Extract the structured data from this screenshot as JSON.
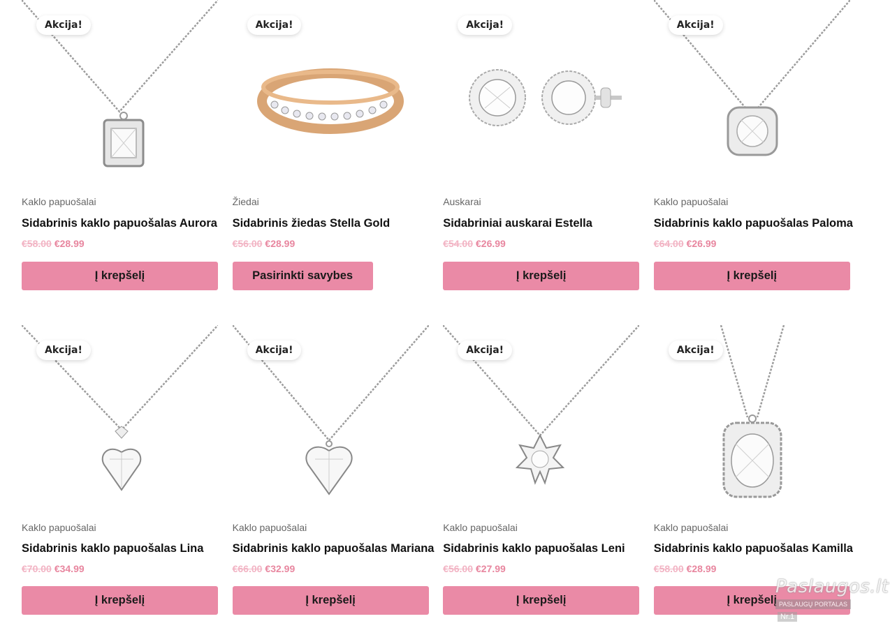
{
  "badge_label": "Akcija!",
  "products": [
    {
      "category": "Kaklo papuošalai",
      "title": "Sidabrinis kaklo papuošalas Aurora",
      "old_price": "€58.00",
      "price": "€28.99",
      "button": "Į krepšelį",
      "image": "pendant-rectangle"
    },
    {
      "category": "Žiedai",
      "title": "Sidabrinis žiedas Stella Gold",
      "old_price": "€56.00",
      "price": "€28.99",
      "button": "Pasirinkti savybes",
      "image": "gold-ring"
    },
    {
      "category": "Auskarai",
      "title": "Sidabriniai auskarai Estella",
      "old_price": "€54.00",
      "price": "€26.99",
      "button": "Į krepšelį",
      "image": "stud-earrings"
    },
    {
      "category": "Kaklo papuošalai",
      "title": "Sidabrinis kaklo papuošalas Paloma",
      "old_price": "€64.00",
      "price": "€26.99",
      "button": "Į krepšelį",
      "image": "pendant-cushion"
    },
    {
      "category": "Kaklo papuošalai",
      "title": "Sidabrinis kaklo papuošalas Lina",
      "old_price": "€70.00",
      "price": "€34.99",
      "button": "Į krepšelį",
      "image": "pendant-heart"
    },
    {
      "category": "Kaklo papuošalai",
      "title": "Sidabrinis kaklo papuošalas Mariana",
      "old_price": "€66.00",
      "price": "€32.99",
      "button": "Į krepšelį",
      "image": "pendant-heart"
    },
    {
      "category": "Kaklo papuošalai",
      "title": "Sidabrinis kaklo papuošalas Leni",
      "old_price": "€56.00",
      "price": "€27.99",
      "button": "Į krepšelį",
      "image": "pendant-star"
    },
    {
      "category": "Kaklo papuošalai",
      "title": "Sidabrinis kaklo papuošalas Kamilla",
      "old_price": "€58.00",
      "price": "€28.99",
      "button": "Į krepšelį",
      "image": "pendant-oval"
    }
  ],
  "watermark": {
    "site": "Paslaugos.lt",
    "subtitle": "PASLAUGŲ PORTALAS",
    "rank": "Nr.1"
  },
  "colors": {
    "button": "#ea8aa6",
    "price": "#e8869f",
    "old_price": "#f2b4c4"
  }
}
